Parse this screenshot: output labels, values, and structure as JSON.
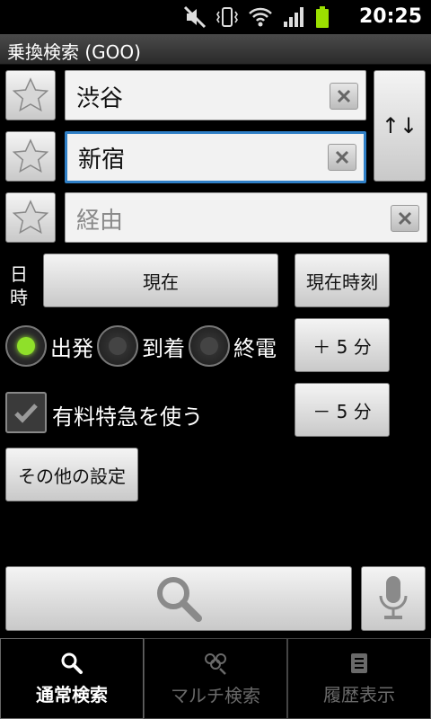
{
  "status_bar": {
    "time": "20:25",
    "icons": [
      "mute-icon",
      "vibrate-icon",
      "wifi-icon",
      "signal-icon",
      "battery-icon"
    ]
  },
  "title": "乗換検索 (GOO)",
  "stations": {
    "from": {
      "value": "渋谷"
    },
    "to": {
      "value": "新宿"
    },
    "via": {
      "placeholder": "経由"
    }
  },
  "swap_icon": "↑↓",
  "date_label": [
    "日",
    "時"
  ],
  "buttons": {
    "now": "現在",
    "current_time": "現在時刻",
    "plus5": "＋ 5 分",
    "minus5": "－ 5 分",
    "other_settings": "その他の設定"
  },
  "radio": {
    "options": [
      "出発",
      "到着",
      "終電"
    ],
    "selected": "出発"
  },
  "checkbox": {
    "label": "有料特急を使う",
    "checked": true
  },
  "tabs": [
    {
      "label": "通常検索",
      "icon": "search-icon",
      "selected": true
    },
    {
      "label": "マルチ検索",
      "icon": "multi-search-icon",
      "selected": false
    },
    {
      "label": "履歴表示",
      "icon": "history-icon",
      "selected": false
    }
  ],
  "colors": {
    "accent_focus": "#2f7fc6",
    "radio_selected": "#8fe02a"
  }
}
